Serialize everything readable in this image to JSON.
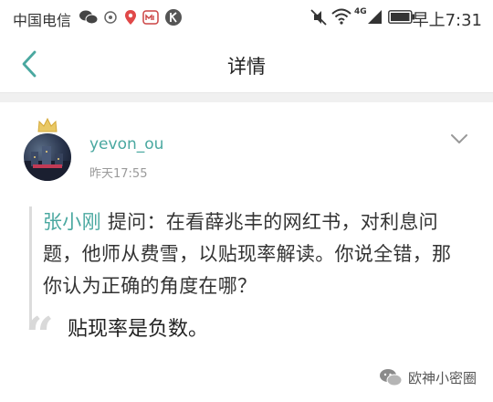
{
  "status_bar": {
    "carrier": "中国电信",
    "network_label": "4G",
    "time": "早上7:31"
  },
  "nav": {
    "title": "详情"
  },
  "post": {
    "username": "yevon_ou",
    "time": "昨天17:55",
    "quote_author": "张小刚",
    "quote_body": " 提问：在看薛兆丰的网红书，对利息问题，他师从费雪，以贴现率解读。你说全错，那你认为正确的角度在哪？",
    "reply": "贴现率是负数。"
  },
  "watermark": {
    "text": "欧神小密圈"
  },
  "colors": {
    "accent": "#4aa8a0",
    "quote_border": "#dcdcdc",
    "divider": "#f0f0f0"
  },
  "icons": {
    "back": "chevron-left-icon",
    "expand": "chevron-down-icon",
    "crown": "crown-icon",
    "quote": "quote-mark-icon",
    "watermark": "wechat-bubble-icon"
  }
}
